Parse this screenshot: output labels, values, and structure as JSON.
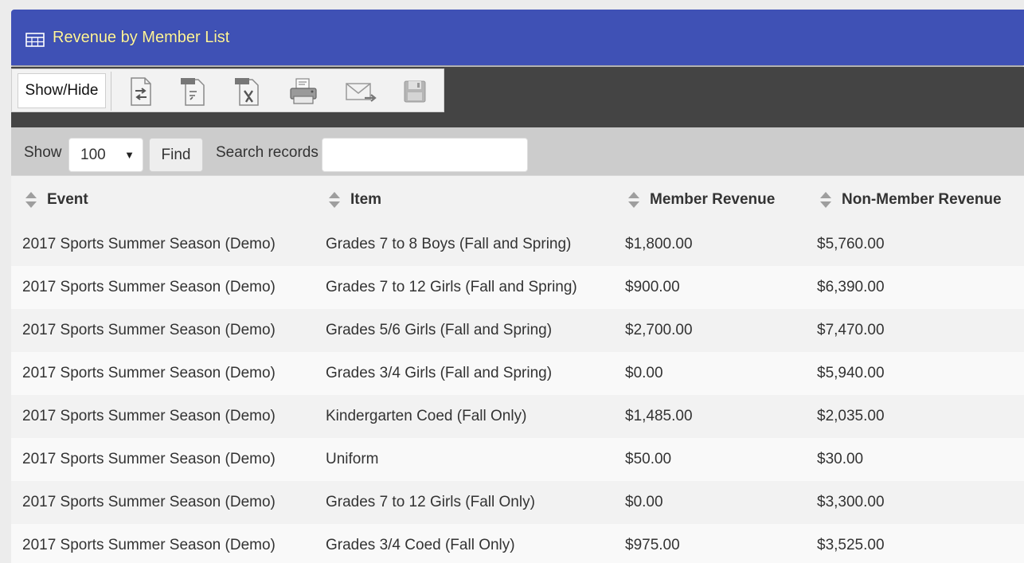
{
  "panel": {
    "title": "Revenue by Member List",
    "title_icon": "table-icon"
  },
  "toolbar": {
    "show_hide_label": "Show/Hide",
    "buttons": [
      {
        "name": "export-icon"
      },
      {
        "name": "csv-export-icon",
        "tag": "CSV"
      },
      {
        "name": "xls-export-icon",
        "tag": "XLS"
      },
      {
        "name": "print-icon"
      },
      {
        "name": "email-icon"
      },
      {
        "name": "save-icon"
      }
    ]
  },
  "search": {
    "show_label": "Show",
    "page_size": "100",
    "find_label": "Find",
    "search_label": "Search records",
    "search_value": ""
  },
  "table": {
    "columns": [
      "Event",
      "Item",
      "Member Revenue",
      "Non-Member Revenue"
    ],
    "rows": [
      [
        "2017 Sports Summer Season (Demo)",
        "Grades 7 to 8 Boys (Fall and Spring)",
        "$1,800.00",
        "$5,760.00"
      ],
      [
        "2017 Sports Summer Season (Demo)",
        "Grades 7 to 12 Girls (Fall and Spring)",
        "$900.00",
        "$6,390.00"
      ],
      [
        "2017 Sports Summer Season (Demo)",
        "Grades 5/6 Girls (Fall and Spring)",
        "$2,700.00",
        "$7,470.00"
      ],
      [
        "2017 Sports Summer Season (Demo)",
        "Grades 3/4 Girls (Fall and Spring)",
        "$0.00",
        "$5,940.00"
      ],
      [
        "2017 Sports Summer Season (Demo)",
        "Kindergarten Coed (Fall Only)",
        "$1,485.00",
        "$2,035.00"
      ],
      [
        "2017 Sports Summer Season (Demo)",
        "Uniform",
        "$50.00",
        "$30.00"
      ],
      [
        "2017 Sports Summer Season (Demo)",
        "Grades 7 to 12 Girls (Fall Only)",
        "$0.00",
        "$3,300.00"
      ],
      [
        "2017 Sports Summer Season (Demo)",
        "Grades 3/4 Coed (Fall Only)",
        "$975.00",
        "$3,525.00"
      ]
    ]
  },
  "colors": {
    "header_bg": "#3f51b5",
    "title_text": "#fff59d",
    "toolbar_bg": "#444444",
    "search_bg": "#cccccc"
  }
}
